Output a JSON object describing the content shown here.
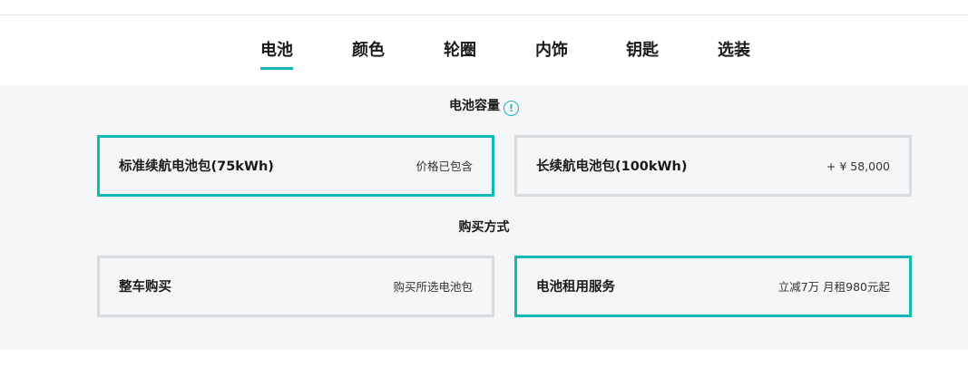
{
  "tabs": [
    {
      "label": "电池",
      "active": true
    },
    {
      "label": "颜色",
      "active": false
    },
    {
      "label": "轮圈",
      "active": false
    },
    {
      "label": "内饰",
      "active": false
    },
    {
      "label": "钥匙",
      "active": false
    },
    {
      "label": "选装",
      "active": false
    }
  ],
  "battery": {
    "title": "电池容量",
    "info_icon_glyph": "!",
    "options": [
      {
        "name": "标准续航电池包(75kWh)",
        "price": "价格已包含",
        "selected": true
      },
      {
        "name": "长续航电池包(100kWh)",
        "price": "+ ¥ 58,000",
        "selected": false
      }
    ]
  },
  "purchase": {
    "title": "购买方式",
    "options": [
      {
        "name": "整车购买",
        "price": "购买所选电池包",
        "selected": false
      },
      {
        "name": "电池租用服务",
        "price": "立减7万 月租980元起",
        "selected": true
      }
    ]
  },
  "colors": {
    "accent": "#12b8b5",
    "panel_bg": "#f5f6f7",
    "border": "#d8dbde"
  }
}
